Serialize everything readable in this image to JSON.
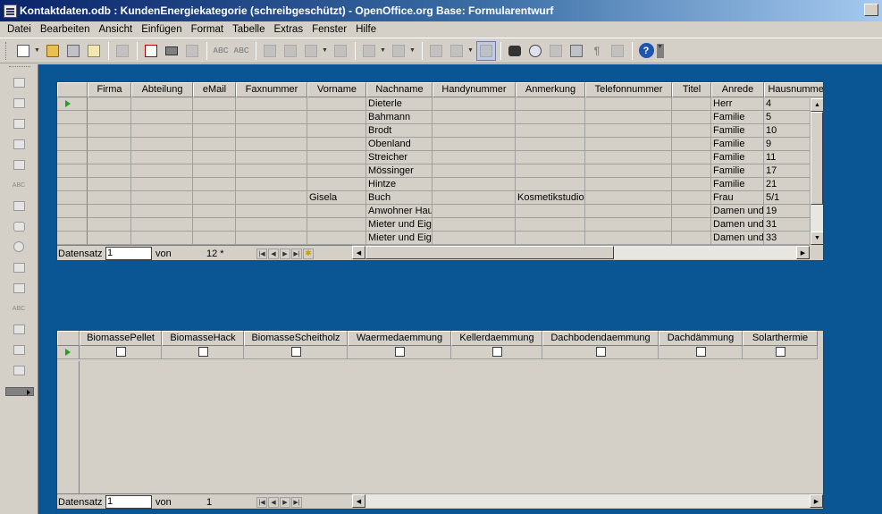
{
  "window": {
    "title": "Kontaktdaten.odb : KundenEnergiekategorie (schreibgeschützt) - OpenOffice.org Base: Formularentwurf"
  },
  "menu": [
    "Datei",
    "Bearbeiten",
    "Ansicht",
    "Einfügen",
    "Format",
    "Tabelle",
    "Extras",
    "Fenster",
    "Hilfe"
  ],
  "toolbar": {
    "spelling_label": "ABC",
    "spelling_auto_label": "ABC",
    "help_label": "?"
  },
  "grid1": {
    "columns": [
      "Firma",
      "Abteilung",
      "eMail",
      "Faxnummer",
      "Vorname",
      "Nachname",
      "Handynummer",
      "Anmerkung",
      "Telefonnummer",
      "Titel",
      "Anrede",
      "Hausnummer"
    ],
    "rows": [
      [
        "",
        "",
        "",
        "",
        "",
        "Dieterle",
        "",
        "",
        "",
        "",
        "Herr",
        "4"
      ],
      [
        "",
        "",
        "",
        "",
        "",
        "Bahmann",
        "",
        "",
        "",
        "",
        "Familie",
        "5"
      ],
      [
        "",
        "",
        "",
        "",
        "",
        "Brodt",
        "",
        "",
        "",
        "",
        "Familie",
        "10"
      ],
      [
        "",
        "",
        "",
        "",
        "",
        "Obenland",
        "",
        "",
        "",
        "",
        "Familie",
        "9"
      ],
      [
        "",
        "",
        "",
        "",
        "",
        "Streicher",
        "",
        "",
        "",
        "",
        "Familie",
        "11"
      ],
      [
        "",
        "",
        "",
        "",
        "",
        "Mössinger",
        "",
        "",
        "",
        "",
        "Familie",
        "17"
      ],
      [
        "",
        "",
        "",
        "",
        "",
        "Hintze",
        "",
        "",
        "",
        "",
        "Familie",
        "21"
      ],
      [
        "",
        "",
        "",
        "",
        "Gisela",
        "Buch",
        "",
        "Kosmetikstudio",
        "",
        "",
        "Frau",
        "5/1"
      ],
      [
        "",
        "",
        "",
        "",
        "",
        "Anwohner Hau",
        "",
        "",
        "",
        "",
        "Damen und",
        "19"
      ],
      [
        "",
        "",
        "",
        "",
        "",
        "Mieter und Eige",
        "",
        "",
        "",
        "",
        "Damen und",
        "31"
      ],
      [
        "",
        "",
        "",
        "",
        "",
        "Mieter und Eige",
        "",
        "",
        "",
        "",
        "Damen und",
        "33"
      ]
    ],
    "nav": {
      "label": "Datensatz",
      "current": "1",
      "von": "von",
      "count": "12 *"
    }
  },
  "grid2": {
    "columns": [
      "BiomassePellet",
      "BiomasseHack",
      "BiomasseScheitholz",
      "Waermedaemmung",
      "Kellerdaemmung",
      "Dachbodendaemmung",
      "Dachdämmung",
      "Solarthermie"
    ],
    "checked": [
      false,
      false,
      false,
      false,
      false,
      false,
      false,
      false
    ],
    "nav": {
      "label": "Datensatz",
      "current": "1",
      "von": "von",
      "count": "1"
    }
  },
  "colors": {
    "workspace": "#0a5694",
    "titlebar_start": "#0a246a",
    "current_row_marker": "#20a020"
  }
}
